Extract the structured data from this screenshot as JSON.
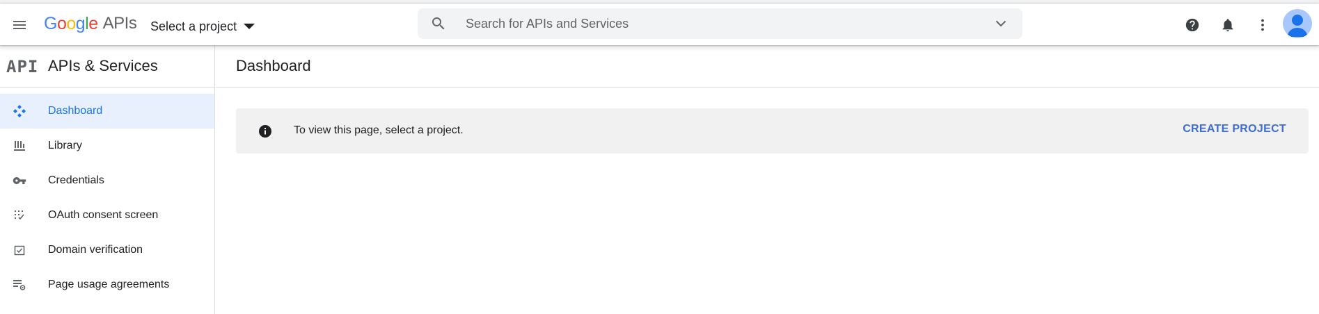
{
  "topbar": {
    "logo_letters": [
      "G",
      "o",
      "o",
      "g",
      "l",
      "e"
    ],
    "logo_suffix": "APIs",
    "project_picker_label": "Select a project",
    "search_placeholder": "Search for APIs and Services",
    "icons": [
      "menu-icon",
      "search-icon",
      "chevron-down-icon",
      "help-icon",
      "notifications-icon",
      "more-vert-icon",
      "avatar"
    ]
  },
  "sidebar": {
    "logo_text": "API",
    "title": "APIs & Services",
    "items": [
      {
        "label": "Dashboard",
        "icon": "dashboard-icon",
        "active": true
      },
      {
        "label": "Library",
        "icon": "library-icon",
        "active": false
      },
      {
        "label": "Credentials",
        "icon": "key-icon",
        "active": false
      },
      {
        "label": "OAuth consent screen",
        "icon": "oauth-consent-icon",
        "active": false
      },
      {
        "label": "Domain verification",
        "icon": "domain-verification-icon",
        "active": false
      },
      {
        "label": "Page usage agreements",
        "icon": "page-usage-settings-icon",
        "active": false
      }
    ]
  },
  "main": {
    "title": "Dashboard",
    "banner": {
      "message": "To view this page, select a project.",
      "action_label": "CREATE PROJECT"
    }
  },
  "colors": {
    "accent_blue": "#1a73e8",
    "active_bg": "#e8f0fe",
    "action_blue": "#3c6cd4",
    "banner_bg": "#f1f1f1",
    "avatar_bg": "#a8c7fa"
  }
}
